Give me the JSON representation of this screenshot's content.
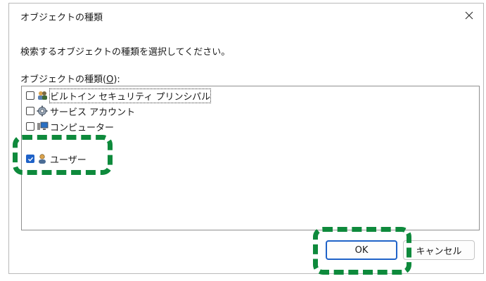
{
  "dialog": {
    "title": "オブジェクトの種類",
    "close_icon": "close-icon"
  },
  "instruction": "検索するオブジェクトの種類を選択してください。",
  "list": {
    "label_prefix": "オブジェクトの種類(",
    "label_mnemonic": "O",
    "label_suffix": "):",
    "items": [
      {
        "label": "ビルトイン セキュリティ プリンシパル",
        "checked": false,
        "icon": "security-principals-icon"
      },
      {
        "label": "サービス アカウント",
        "checked": false,
        "icon": "service-account-icon"
      },
      {
        "label": "コンピューター",
        "checked": false,
        "icon": "computer-icon"
      },
      {
        "label": "ユーザー",
        "checked": true,
        "icon": "user-icon"
      }
    ]
  },
  "buttons": {
    "ok": "OK",
    "cancel": "キャンセル"
  },
  "colors": {
    "accent": "#1f62c8",
    "highlight": "#0e8a3c"
  }
}
